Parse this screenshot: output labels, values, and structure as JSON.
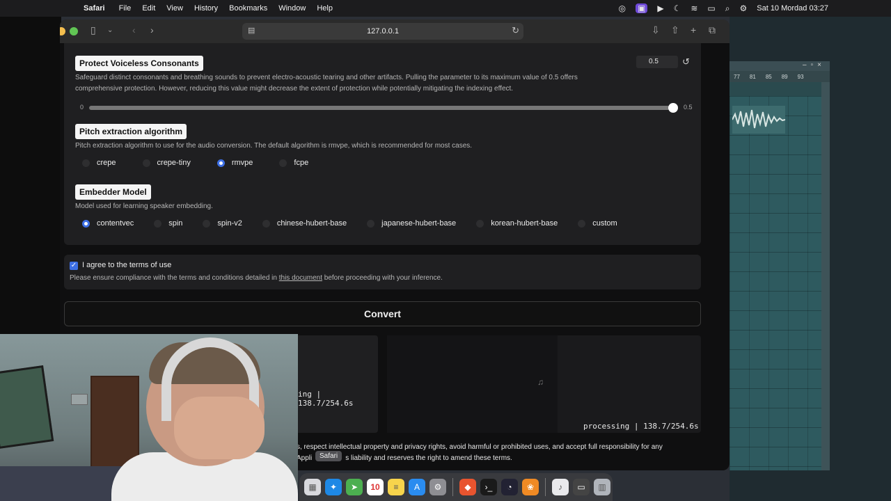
{
  "menubar": {
    "app_name": "Safari",
    "menus": [
      "File",
      "Edit",
      "View",
      "History",
      "Bookmarks",
      "Window",
      "Help"
    ],
    "datetime": "Sat 10 Mordad  03:27"
  },
  "browser": {
    "url": "127.0.0.1"
  },
  "protect": {
    "title": "Protect Voiceless Consonants",
    "description": "Safeguard distinct consonants and breathing sounds to prevent electro-acoustic tearing and other artifacts. Pulling the parameter to its maximum value of 0.5 offers comprehensive protection. However, reducing this value might decrease the extent of protection while potentially mitigating the indexing effect.",
    "value": "0.5",
    "slider_min": "0",
    "slider_max": "0.5",
    "slider_fraction": 1.0
  },
  "pitch": {
    "title": "Pitch extraction algorithm",
    "description": "Pitch extraction algorithm to use for the audio conversion. The default algorithm is rmvpe, which is recommended for most cases.",
    "options": [
      "crepe",
      "crepe-tiny",
      "rmvpe",
      "fcpe"
    ],
    "selected": "rmvpe"
  },
  "embedder": {
    "title": "Embedder Model",
    "description": "Model used for learning speaker embedding.",
    "options": [
      "contentvec",
      "spin",
      "spin-v2",
      "chinese-hubert-base",
      "japanese-hubert-base",
      "korean-hubert-base",
      "custom"
    ],
    "selected": "contentvec"
  },
  "terms": {
    "label": "I agree to the terms of use",
    "desc_before": "Please ensure compliance with the terms and conditions detailed in ",
    "link": "this document",
    "desc_after": " before proceeding with your inference."
  },
  "convert_label": "Convert",
  "output": {
    "left_progress": "ing | 138.7/254.6s",
    "right_progress": "processing | 138.7/254.6s"
  },
  "footer": {
    "line1": "s, respect intellectual property and privacy rights, avoid harmful or prohibited uses, and accept full responsibility for any",
    "line2_a": "Appli",
    "line2_b": "s liability and reserves the right to amend these terms."
  },
  "dock": {
    "tooltip": "Safari",
    "calendar_day": "10"
  },
  "daw": {
    "ruler": [
      "77",
      "81",
      "85",
      "89",
      "93"
    ]
  }
}
